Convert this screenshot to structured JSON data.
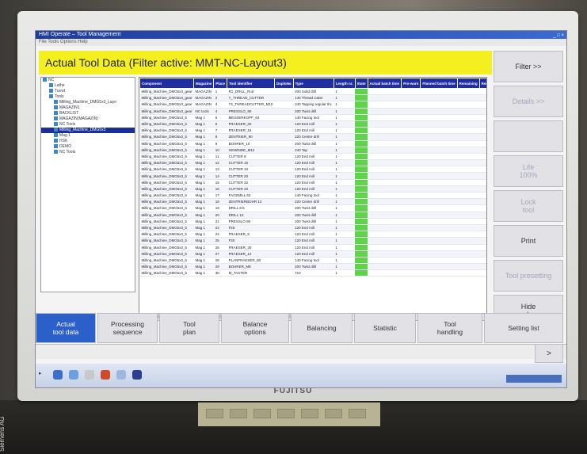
{
  "window": {
    "title": "HMI Operate – Tool Management",
    "menu": "File  Tools  Options  Help",
    "controls": "_ □ ×"
  },
  "header": {
    "title": "Actual Tool Data (Filter active: MMT-NC-Layout3)"
  },
  "tree": {
    "items": [
      {
        "label": "NC",
        "selected": false
      },
      {
        "label": "Lathe",
        "selected": false
      },
      {
        "label": "Turret",
        "selected": false
      },
      {
        "label": "Tools",
        "selected": false
      },
      {
        "label": "Milling_Machine_DMG5x3_Layo",
        "selected": false
      },
      {
        "label": "MAGAZIN1",
        "selected": false
      },
      {
        "label": "BACKLIST",
        "selected": false
      },
      {
        "label": "MAGAZIN(MAGAZIN)",
        "selected": false
      },
      {
        "label": "NC Tools",
        "selected": false
      },
      {
        "label": "Milling_Machine_DMG5x3",
        "selected": true
      },
      {
        "label": "Mag 1",
        "selected": false
      },
      {
        "label": "HSK",
        "selected": false
      },
      {
        "label": "DEMO",
        "selected": false
      },
      {
        "label": "NC Tools",
        "selected": false
      }
    ]
  },
  "table": {
    "headers": [
      "Component",
      "Magazine",
      "Place",
      "Tool identifier",
      "DuploNo",
      "Type",
      "Length nr.",
      "State",
      "Actual batch time",
      "Pre-warn",
      "Planned batch time",
      "Remaining",
      "Remaining parts"
    ],
    "rows": [
      {
        "comp": "Milling_Machine_DMG5x3_gear",
        "mag": "MAGAZIN",
        "place": "1",
        "tool": "R1_DRILL_Rod",
        "duplo": "",
        "type": "200 Solid drill",
        "len": "1"
      },
      {
        "comp": "Milling_Machine_DMG5x3_gear",
        "mag": "MAGAZIN",
        "place": "2",
        "tool": "T_THREAD_CUTTER",
        "duplo": "",
        "type": "140 Thread cutter",
        "len": "1"
      },
      {
        "comp": "Milling_Machine_DMG5x3_gear",
        "mag": "MAGAZIN",
        "place": "3",
        "tool": "T4_THREADCUTTER_M10",
        "duplo": "",
        "type": "240 Tapping regular thr.",
        "len": "1"
      },
      {
        "comp": "Milling_Machine_DMG5x3_gear",
        "mag": "NC tools",
        "place": "4",
        "tool": "PRESSLO_90",
        "duplo": "",
        "type": "200 Twist drill",
        "len": "1"
      },
      {
        "comp": "Milling_Machine_DMG5x3_b",
        "mag": "Mag 1",
        "place": "5",
        "tool": "MESSERKOPF_63",
        "duplo": "",
        "type": "140 Facing tool",
        "len": "1"
      },
      {
        "comp": "Milling_Machine_DMG5x3_b",
        "mag": "Mag 1",
        "place": "6",
        "tool": "FRAESER_20",
        "duplo": "",
        "type": "120 End mill",
        "len": "1"
      },
      {
        "comp": "Milling_Machine_DMG5x3_b",
        "mag": "Mag 1",
        "place": "7",
        "tool": "FRAESER_16",
        "duplo": "",
        "type": "120 End mill",
        "len": "1"
      },
      {
        "comp": "Milling_Machine_DMG5x3_b",
        "mag": "Mag 1",
        "place": "8",
        "tool": "ZENTRIER_90",
        "duplo": "",
        "type": "220 Centre drill",
        "len": "1"
      },
      {
        "comp": "Milling_Machine_DMG5x3_b",
        "mag": "Mag 1",
        "place": "9",
        "tool": "BOHRER_10",
        "duplo": "",
        "type": "200 Twist drill",
        "len": "1"
      },
      {
        "comp": "Milling_Machine_DMG5x3_b",
        "mag": "Mag 1",
        "place": "10",
        "tool": "GEWINDE_M12",
        "duplo": "",
        "type": "240 Tap",
        "len": "1"
      },
      {
        "comp": "Milling_Machine_DMG5x3_b",
        "mag": "Mag 1",
        "place": "11",
        "tool": "CUTTER 8",
        "duplo": "",
        "type": "120 End mill",
        "len": "1"
      },
      {
        "comp": "Milling_Machine_DMG5x3_b",
        "mag": "Mag 1",
        "place": "12",
        "tool": "CUTTER 16",
        "duplo": "",
        "type": "120 End mill",
        "len": "1"
      },
      {
        "comp": "Milling_Machine_DMG5x3_b",
        "mag": "Mag 1",
        "place": "13",
        "tool": "CUTTER 10",
        "duplo": "",
        "type": "120 End mill",
        "len": "1"
      },
      {
        "comp": "Milling_Machine_DMG5x3_b",
        "mag": "Mag 1",
        "place": "14",
        "tool": "CUTTER 20",
        "duplo": "",
        "type": "120 End mill",
        "len": "1"
      },
      {
        "comp": "Milling_Machine_DMG5x3_b",
        "mag": "Mag 1",
        "place": "15",
        "tool": "CUTTER 32",
        "duplo": "",
        "type": "120 End mill",
        "len": "1"
      },
      {
        "comp": "Milling_Machine_DMG5x3_b",
        "mag": "Mag 1",
        "place": "16",
        "tool": "CUTTER 40",
        "duplo": "",
        "type": "120 End mill",
        "len": "1"
      },
      {
        "comp": "Milling_Machine_DMG5x3_b",
        "mag": "Mag 1",
        "place": "17",
        "tool": "FACEMILL 63",
        "duplo": "",
        "type": "140 Facing tool",
        "len": "1"
      },
      {
        "comp": "Milling_Machine_DMG5x3_b",
        "mag": "Mag 1",
        "place": "18",
        "tool": "ZENTRIERBOHR 12",
        "duplo": "",
        "type": "220 Centre drill",
        "len": "1"
      },
      {
        "comp": "Milling_Machine_DMG5x3_b",
        "mag": "Mag 1",
        "place": "19",
        "tool": "DRILL 8.5",
        "duplo": "",
        "type": "200 Twist drill",
        "len": "1"
      },
      {
        "comp": "Milling_Machine_DMG5x3_b",
        "mag": "Mag 1",
        "place": "20",
        "tool": "DRILL 10",
        "duplo": "",
        "type": "200 Twist drill",
        "len": "1"
      },
      {
        "comp": "Milling_Machine_DMG5x3_b",
        "mag": "Mag 1",
        "place": "21",
        "tool": "PRESSLO 90",
        "duplo": "",
        "type": "200 Twist drill",
        "len": "1"
      },
      {
        "comp": "Milling_Machine_DMG5x3_b",
        "mag": "Mag 1",
        "place": "22",
        "tool": "F25",
        "duplo": "",
        "type": "120 End mill",
        "len": "1"
      },
      {
        "comp": "Milling_Machine_DMG5x3_b",
        "mag": "Mag 1",
        "place": "24",
        "tool": "FRAESER_8",
        "duplo": "",
        "type": "120 End mill",
        "len": "1"
      },
      {
        "comp": "Milling_Machine_DMG5x3_b",
        "mag": "Mag 1",
        "place": "25",
        "tool": "F30",
        "duplo": "",
        "type": "120 End mill",
        "len": "1"
      },
      {
        "comp": "Milling_Machine_DMG5x3_b",
        "mag": "Mag 1",
        "place": "26",
        "tool": "FRAESER_30",
        "duplo": "",
        "type": "120 End mill",
        "len": "1"
      },
      {
        "comp": "Milling_Machine_DMG5x3_b",
        "mag": "Mag 1",
        "place": "27",
        "tool": "FRAESER_12",
        "duplo": "",
        "type": "120 End mill",
        "len": "1"
      },
      {
        "comp": "Milling_Machine_DMG5x3_b",
        "mag": "Mag 1",
        "place": "28",
        "tool": "PLANFRAESER_80",
        "duplo": "",
        "type": "140 Facing tool",
        "len": "1"
      },
      {
        "comp": "Milling_Machine_DMG5x3_b",
        "mag": "Mag 1",
        "place": "29",
        "tool": "BOHRER_M8",
        "duplo": "",
        "type": "200 Twist drill",
        "len": "1"
      },
      {
        "comp": "Milling_Machine_DMG5x3_b",
        "mag": "Mag 1",
        "place": "30",
        "tool": "M_TASTER",
        "duplo": "",
        "type": "710",
        "len": "1"
      }
    ]
  },
  "right_softkeys": [
    {
      "label": "Filter >>",
      "dim": false
    },
    {
      "label": "Details >>",
      "dim": true
    },
    {
      "label": "",
      "dim": false
    },
    {
      "label": "Life\n100%",
      "dim": true
    },
    {
      "label": "Lock\ntool",
      "dim": true
    },
    {
      "label": "Print",
      "dim": false
    },
    {
      "label": "Tool presetting",
      "dim": true
    },
    {
      "label": "Hide\nexplorer",
      "dim": false
    }
  ],
  "bottom_softkeys": [
    {
      "label": "Actual\ntool data",
      "active": true
    },
    {
      "label": "Processing\nsequence",
      "active": false
    },
    {
      "label": "Tool\nplan",
      "active": false
    },
    {
      "label": "Balance\noptions",
      "active": false
    },
    {
      "label": "Balancing",
      "active": false
    },
    {
      "label": "Statistic",
      "active": false
    },
    {
      "label": "Tool\nhandling",
      "active": false
    },
    {
      "label": "Setting list",
      "active": false
    }
  ],
  "next_arrow": ">",
  "monitor": {
    "brand": "FUJITSU"
  },
  "credit": "Siemens AG",
  "colors": {
    "header_yellow": "#f4f020",
    "table_header": "#1f2fa2",
    "state_green": "#5fd44a",
    "active_key": "#2b5fc9"
  }
}
